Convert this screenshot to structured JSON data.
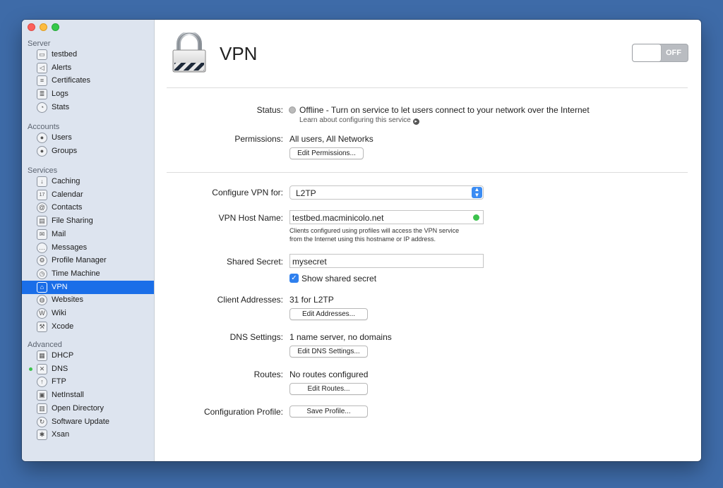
{
  "window": {
    "title": "VPN"
  },
  "sidebar": {
    "sections": [
      {
        "label": "Server",
        "items": [
          {
            "label": "testbed",
            "icon": "server-icon"
          },
          {
            "label": "Alerts",
            "icon": "megaphone-icon"
          },
          {
            "label": "Certificates",
            "icon": "certificate-icon"
          },
          {
            "label": "Logs",
            "icon": "logs-icon"
          },
          {
            "label": "Stats",
            "icon": "stats-icon"
          }
        ]
      },
      {
        "label": "Accounts",
        "items": [
          {
            "label": "Users",
            "icon": "user-icon"
          },
          {
            "label": "Groups",
            "icon": "groups-icon"
          }
        ]
      },
      {
        "label": "Services",
        "items": [
          {
            "label": "Caching",
            "icon": "caching-icon"
          },
          {
            "label": "Calendar",
            "icon": "calendar-icon",
            "glyph": "17"
          },
          {
            "label": "Contacts",
            "icon": "contacts-icon"
          },
          {
            "label": "File Sharing",
            "icon": "file-sharing-icon"
          },
          {
            "label": "Mail",
            "icon": "mail-icon"
          },
          {
            "label": "Messages",
            "icon": "messages-icon"
          },
          {
            "label": "Profile Manager",
            "icon": "profile-manager-icon"
          },
          {
            "label": "Time Machine",
            "icon": "time-machine-icon"
          },
          {
            "label": "VPN",
            "icon": "vpn-lock-icon",
            "selected": true
          },
          {
            "label": "Websites",
            "icon": "globe-icon"
          },
          {
            "label": "Wiki",
            "icon": "wiki-icon"
          },
          {
            "label": "Xcode",
            "icon": "xcode-icon"
          }
        ]
      },
      {
        "label": "Advanced",
        "items": [
          {
            "label": "DHCP",
            "icon": "dhcp-icon"
          },
          {
            "label": "DNS",
            "icon": "dns-icon",
            "running": true
          },
          {
            "label": "FTP",
            "icon": "ftp-icon"
          },
          {
            "label": "NetInstall",
            "icon": "netinstall-icon"
          },
          {
            "label": "Open Directory",
            "icon": "open-directory-icon"
          },
          {
            "label": "Software Update",
            "icon": "software-update-icon"
          },
          {
            "label": "Xsan",
            "icon": "xsan-icon"
          }
        ]
      }
    ]
  },
  "header": {
    "title": "VPN",
    "toggle_label": "OFF"
  },
  "status": {
    "label": "Status:",
    "value": "Offline - Turn on service to let users connect to your network over the Internet",
    "link": "Learn about configuring this service"
  },
  "permissions": {
    "label": "Permissions:",
    "value": "All users, All Networks",
    "button": "Edit Permissions..."
  },
  "configure": {
    "label": "Configure VPN for:",
    "value": "L2TP"
  },
  "host": {
    "label": "VPN Host Name:",
    "value": "testbed.macminicolo.net",
    "help_line1": "Clients configured using profiles will access the VPN service",
    "help_line2": "from the Internet using this hostname or IP address."
  },
  "secret": {
    "label": "Shared Secret:",
    "value": "mysecret",
    "show_label": "Show shared secret"
  },
  "client": {
    "label": "Client Addresses:",
    "value": "31 for L2TP",
    "button": "Edit Addresses..."
  },
  "dns": {
    "label": "DNS Settings:",
    "value": "1 name server, no domains",
    "button": "Edit DNS Settings..."
  },
  "routes": {
    "label": "Routes:",
    "value": "No routes configured",
    "button": "Edit Routes..."
  },
  "profile": {
    "label": "Configuration Profile:",
    "button": "Save Profile..."
  },
  "colors": {
    "accent": "#1a6ee8",
    "desktop": "#3e6ba8",
    "status_ok": "#3cc24d"
  }
}
